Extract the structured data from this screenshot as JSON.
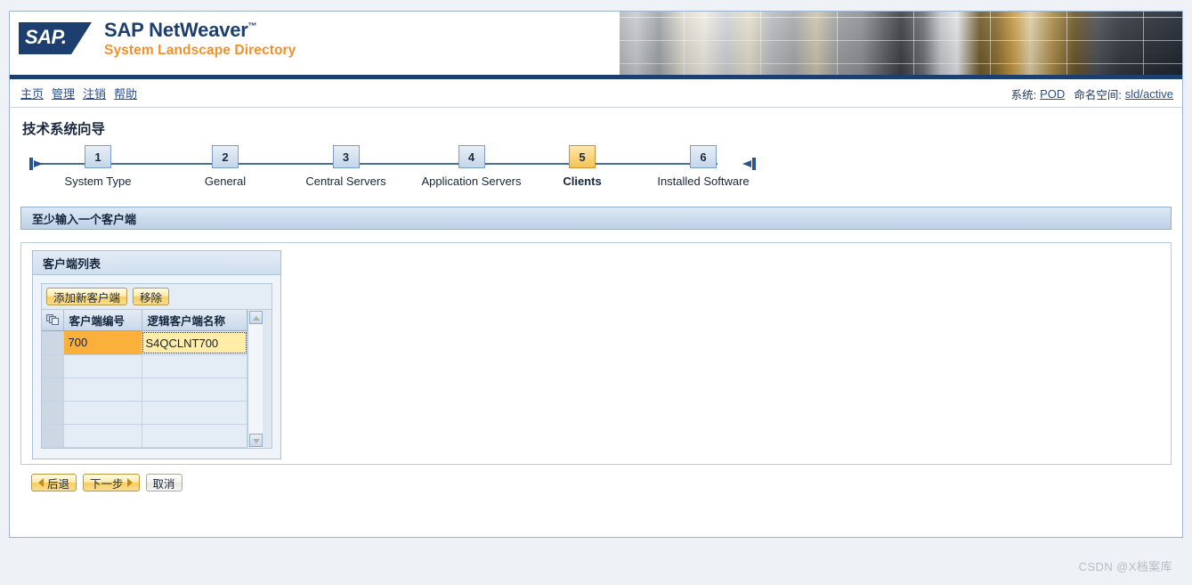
{
  "masthead": {
    "logo_text": "SAP.",
    "product_line1": "SAP NetWeaver",
    "product_line1_tm": "™",
    "product_line2": "System Landscape Directory"
  },
  "topnav": {
    "links": [
      {
        "label": "主页",
        "name": "nav-home"
      },
      {
        "label": "管理",
        "name": "nav-administration"
      },
      {
        "label": "注销",
        "name": "nav-logoff"
      },
      {
        "label": "帮助",
        "name": "nav-help"
      }
    ],
    "system_label": "系统:",
    "system_value": "POD",
    "namespace_label": "命名空间:",
    "namespace_value": "sld/active"
  },
  "wizard": {
    "title": "技术系统向导",
    "steps": [
      {
        "number": "1",
        "label": "System Type",
        "active": false
      },
      {
        "number": "2",
        "label": "General",
        "active": false
      },
      {
        "number": "3",
        "label": "Central Servers",
        "active": false
      },
      {
        "number": "4",
        "label": "Application Servers",
        "active": false
      },
      {
        "number": "5",
        "label": "Clients",
        "active": true
      },
      {
        "number": "6",
        "label": "Installed Software",
        "active": false
      }
    ]
  },
  "instruction": {
    "text": "至少输入一个客户端"
  },
  "client_panel": {
    "title": "客户端列表",
    "toolbar": {
      "add_label": "添加新客户端",
      "remove_label": "移除"
    },
    "table": {
      "select_icon": "multi-select-icon",
      "columns": [
        "客户端编号",
        "逻辑客户端名称"
      ],
      "rows": [
        {
          "client_number": "700",
          "logical_name": "S4QCLNT700",
          "selected": true,
          "editing": true
        },
        {
          "client_number": "",
          "logical_name": "",
          "selected": false,
          "editing": false
        },
        {
          "client_number": "",
          "logical_name": "",
          "selected": false,
          "editing": false
        },
        {
          "client_number": "",
          "logical_name": "",
          "selected": false,
          "editing": false
        },
        {
          "client_number": "",
          "logical_name": "",
          "selected": false,
          "editing": false
        }
      ]
    }
  },
  "footer": {
    "back_label": "后退",
    "next_label": "下一步",
    "cancel_label": "取消"
  },
  "watermark": {
    "text": "CSDN @X档案库"
  },
  "colors": {
    "brand_navy": "#1c3f70",
    "brand_orange": "#f0912d",
    "active_step": "#f3c455",
    "selected_cell": "#fbb03b",
    "edit_field": "#ffeda8",
    "link": "#2a4d8f"
  }
}
